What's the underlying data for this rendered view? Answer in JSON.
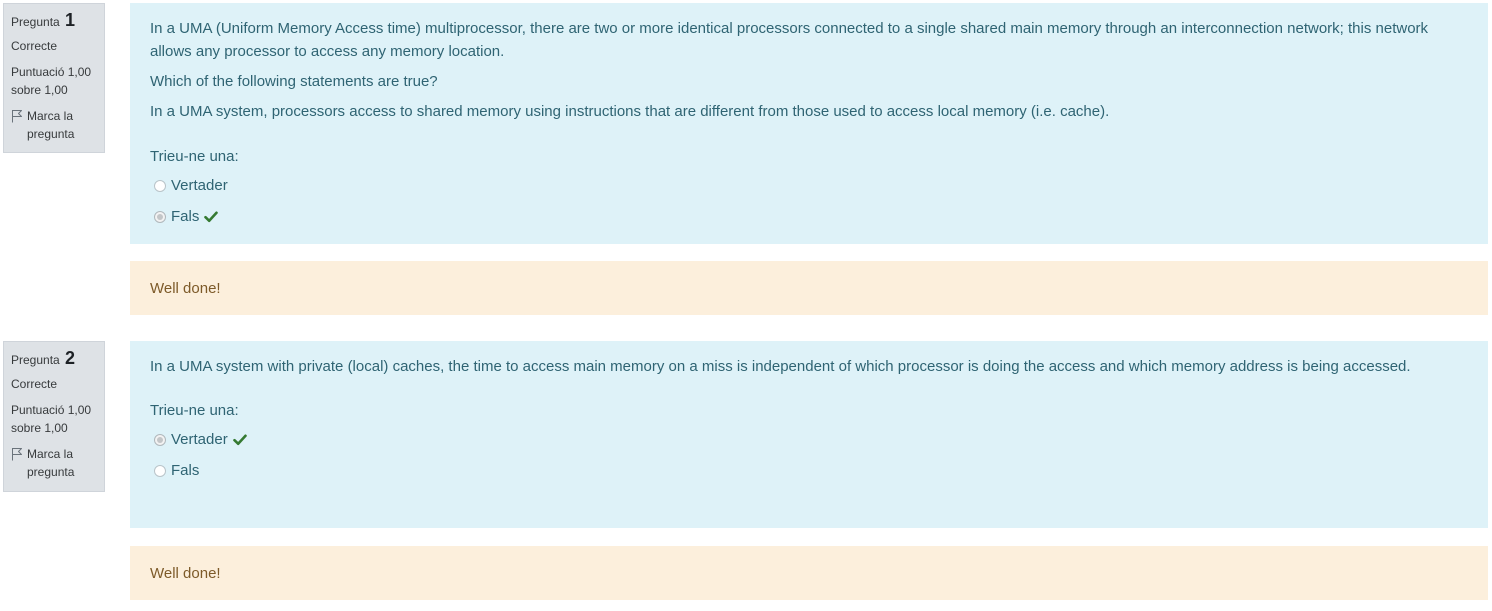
{
  "questions": [
    {
      "label": "Pregunta",
      "number": "1",
      "state": "Correcte",
      "grade_line1": "Puntuació 1,00",
      "grade_line2": "sobre 1,00",
      "flag_label": "Marca la pregunta",
      "text": [
        "In a UMA (Uniform Memory Access time) multiprocessor, there are two or more identical processors connected to a single shared main memory through an interconnection network; this network allows any processor to access any memory location.",
        "Which of the following statements are true?",
        "In a UMA system, processors access to shared memory using instructions that are different from those used to access local memory (i.e. cache)."
      ],
      "prompt": "Trieu-ne una:",
      "answers": [
        {
          "label": "Vertader",
          "selected": false,
          "correct_mark": false
        },
        {
          "label": "Fals",
          "selected": true,
          "correct_mark": true
        }
      ],
      "feedback": "Well done!"
    },
    {
      "label": "Pregunta",
      "number": "2",
      "state": "Correcte",
      "grade_line1": "Puntuació 1,00",
      "grade_line2": "sobre 1,00",
      "flag_label": "Marca la pregunta",
      "text": [
        "In a UMA system with private (local) caches, the time to access main memory on a miss is independent of which processor is doing the access and which memory address is being accessed."
      ],
      "prompt": "Trieu-ne una:",
      "answers": [
        {
          "label": "Vertader",
          "selected": true,
          "correct_mark": true
        },
        {
          "label": "Fals",
          "selected": false,
          "correct_mark": false
        }
      ],
      "feedback": "Well done!"
    }
  ],
  "icons": {
    "flag": "flag-icon",
    "check": "check-icon"
  },
  "colors": {
    "info_bg": "#dee2e6",
    "formulation_bg": "#def2f8",
    "formulation_text": "#2f6473",
    "outcome_bg": "#fcefdc",
    "outcome_text": "#7d5a29",
    "correct_green": "#357a32"
  }
}
